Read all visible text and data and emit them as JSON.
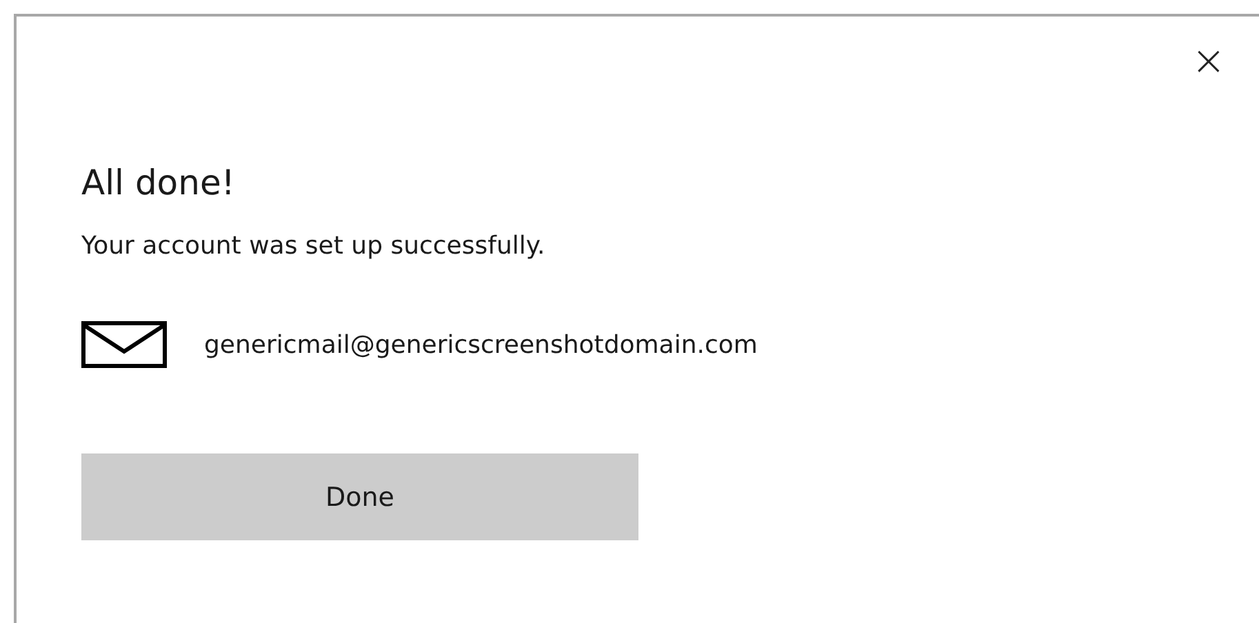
{
  "dialog": {
    "close": "×",
    "title": "All done!",
    "message": "Your account was set up successfully.",
    "account": "genericmail@genericscreenshotdomain.com",
    "buttons": [
      "Done"
    ]
  }
}
